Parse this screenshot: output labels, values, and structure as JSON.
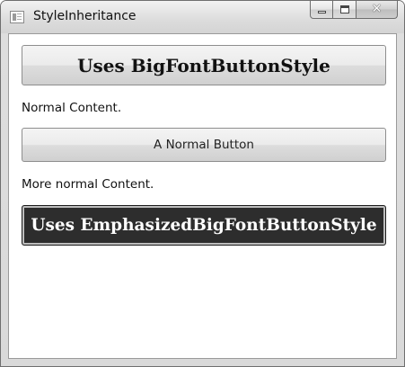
{
  "window": {
    "title": "StyleInheritance",
    "icon": "window-app-icon",
    "caption_buttons": {
      "minimize_icon": "minimize-icon",
      "maximize_icon": "maximize-icon",
      "close_icon": "close-icon",
      "close_glyph": "✕"
    }
  },
  "content": {
    "big_button_label": "Uses BigFontButtonStyle",
    "normal_text_1": "Normal Content.",
    "normal_button_label": "A Normal Button",
    "normal_text_2": "More normal Content.",
    "emphasized_button_label": "Uses EmphasizedBigFontButtonStyle"
  },
  "colors": {
    "emphasized_button_background": "#2d2d2d",
    "emphasized_button_text": "#ffffff"
  }
}
